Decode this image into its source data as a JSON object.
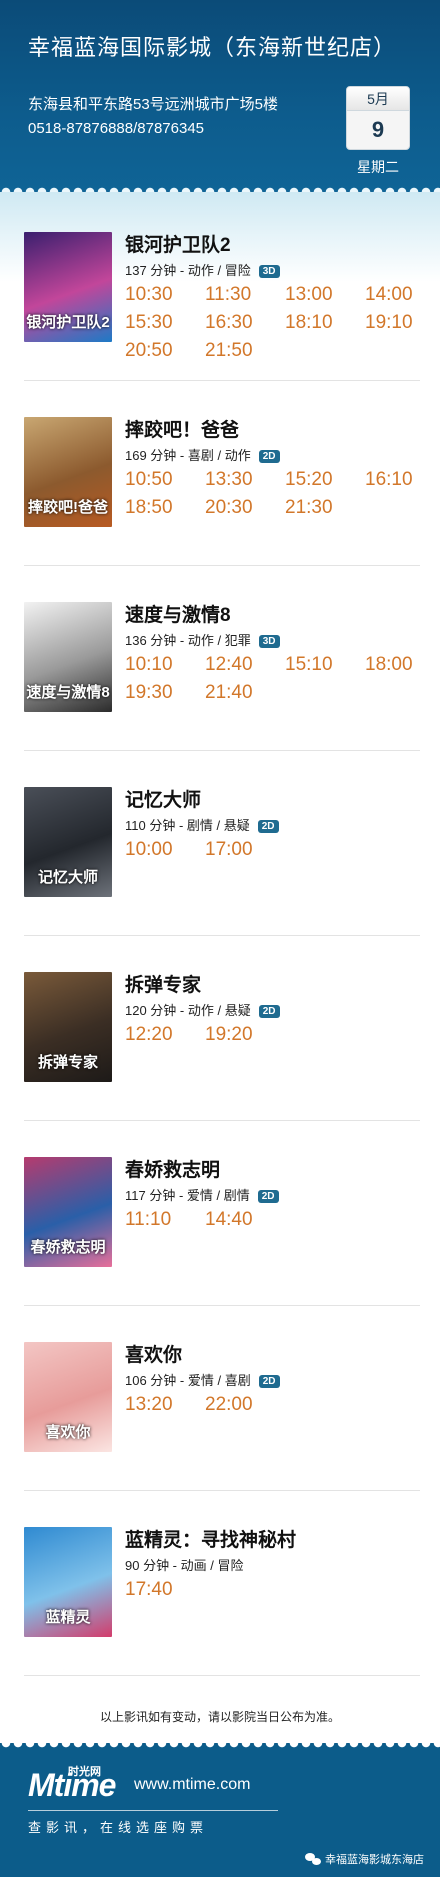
{
  "header": {
    "cinema_name": "幸福蓝海国际影城（东海新世纪店）",
    "address": "东海县和平东路53号远洲城市广场5楼",
    "phone": "0518-87876888/87876345",
    "date": {
      "month": "5月",
      "day": "9",
      "weekday": "星期二"
    }
  },
  "movies": [
    {
      "title": "银河护卫队2",
      "meta": "137 分钟 - 动作 / 冒险",
      "format": "3D",
      "times": [
        "10:30",
        "11:30",
        "13:00",
        "14:00",
        "15:30",
        "16:30",
        "18:10",
        "19:10",
        "20:50",
        "21:50"
      ],
      "poster_text": "银河护卫队2",
      "poster_colors": [
        "#3a1f6e",
        "#c2469a",
        "#1d7ac6"
      ]
    },
    {
      "title": "摔跤吧！爸爸",
      "meta": "169 分钟 - 喜剧 / 动作",
      "format": "2D",
      "times": [
        "10:50",
        "13:30",
        "15:20",
        "16:10",
        "18:50",
        "20:30",
        "21:30"
      ],
      "poster_text": "摔跤吧!爸爸",
      "poster_colors": [
        "#c9a772",
        "#8c5a2e",
        "#b85a22"
      ]
    },
    {
      "title": "速度与激情8",
      "meta": "136 分钟 - 动作 / 犯罪",
      "format": "3D",
      "times": [
        "10:10",
        "12:40",
        "15:10",
        "18:00",
        "19:30",
        "21:40"
      ],
      "poster_text": "速度与激情8",
      "poster_colors": [
        "#f2f2f2",
        "#9a9a9a",
        "#2b2b2b"
      ]
    },
    {
      "title": "记忆大师",
      "meta": "110 分钟 - 剧情 / 悬疑",
      "format": "2D",
      "times": [
        "10:00",
        "17:00"
      ],
      "poster_text": "记忆大师",
      "poster_colors": [
        "#4a4f58",
        "#23272d",
        "#6d727a"
      ]
    },
    {
      "title": "拆弹专家",
      "meta": "120 分钟 - 动作 / 悬疑",
      "format": "2D",
      "times": [
        "12:20",
        "19:20"
      ],
      "poster_text": "拆弹专家",
      "poster_colors": [
        "#7a5a3a",
        "#3b2e24",
        "#1d1a18"
      ]
    },
    {
      "title": "春娇救志明",
      "meta": "117 分钟 - 爱情 / 剧情",
      "format": "2D",
      "times": [
        "11:10",
        "14:40"
      ],
      "poster_text": "春娇救志明",
      "poster_colors": [
        "#b63b6e",
        "#2a5fa8",
        "#e86f9a"
      ]
    },
    {
      "title": "喜欢你",
      "meta": "106 分钟 - 爱情 / 喜剧",
      "format": "2D",
      "times": [
        "13:20",
        "22:00"
      ],
      "poster_text": "喜欢你",
      "poster_colors": [
        "#f3c6c4",
        "#e79c9a",
        "#fbe5e2"
      ]
    },
    {
      "title": "蓝精灵：寻找神秘村",
      "meta": "90 分钟 - 动画 / 冒险",
      "format": "",
      "times": [
        "17:40"
      ],
      "poster_text": "蓝精灵",
      "poster_colors": [
        "#2f8ad1",
        "#7fc1ea",
        "#d33c6b"
      ]
    }
  ],
  "notice": "以上影讯如有变动，请以影院当日公布为准。",
  "footer": {
    "logo_main": "Mtime",
    "logo_cn": "时光网",
    "site": "www.mtime.com",
    "slogan": "查影讯，在线选座购票",
    "wechat_account": "幸福蓝海影城东海店"
  }
}
